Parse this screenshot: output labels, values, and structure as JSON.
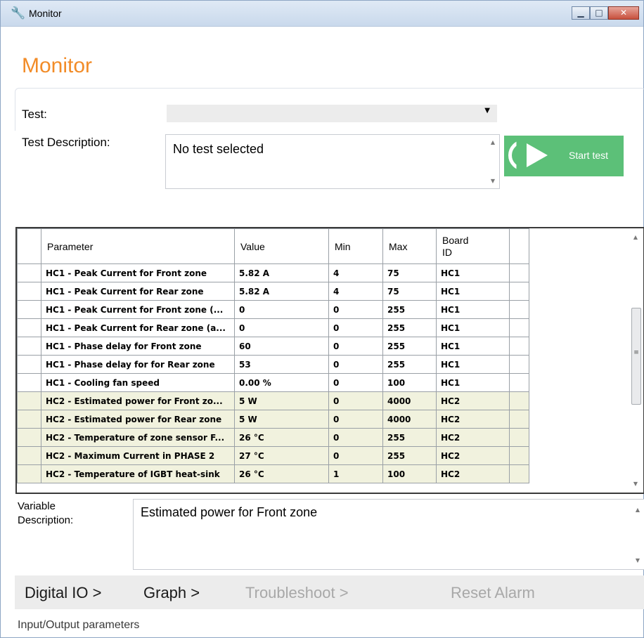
{
  "window": {
    "title": "Monitor",
    "controls": {
      "minimize": "▁",
      "maximize": "□",
      "close": "✕"
    }
  },
  "page": {
    "title": "Monitor"
  },
  "test": {
    "label": "Test:",
    "selected": "",
    "description_label": "Test Description:",
    "description": "No test selected",
    "start_button": "Start test"
  },
  "grid": {
    "columns": [
      "Parameter",
      "Value",
      "Min",
      "Max",
      "Board ID"
    ],
    "rows": [
      {
        "parameter": "HC1 - Peak Current for Front zone",
        "value": "5.82 A",
        "min": "4",
        "max": "75",
        "board": "HC1"
      },
      {
        "parameter": "HC1 - Peak Current for Rear zone",
        "value": "5.82 A",
        "min": "4",
        "max": "75",
        "board": "HC1"
      },
      {
        "parameter": "HC1 - Peak Current for Front zone (...",
        "value": "0",
        "min": "0",
        "max": "255",
        "board": "HC1"
      },
      {
        "parameter": "HC1 - Peak Current for Rear zone (a...",
        "value": "0",
        "min": "0",
        "max": "255",
        "board": "HC1"
      },
      {
        "parameter": "HC1 - Phase delay for Front zone",
        "value": "60",
        "min": "0",
        "max": "255",
        "board": "HC1"
      },
      {
        "parameter": "HC1 - Phase delay for for Rear zone",
        "value": "53",
        "min": "0",
        "max": "255",
        "board": "HC1"
      },
      {
        "parameter": "HC1 - Cooling fan speed",
        "value": "0.00 %",
        "min": "0",
        "max": "100",
        "board": "HC1"
      },
      {
        "parameter": "HC2 - Estimated power for Front zo...",
        "value": "5 W",
        "min": "0",
        "max": "4000",
        "board": "HC2"
      },
      {
        "parameter": "HC2 - Estimated power for Rear zone",
        "value": "5 W",
        "min": "0",
        "max": "4000",
        "board": "HC2"
      },
      {
        "parameter": "HC2 - Temperature of zone sensor F...",
        "value": "26 °C",
        "min": "0",
        "max": "255",
        "board": "HC2"
      },
      {
        "parameter": "HC2 - Maximum Current in PHASE 2",
        "value": "27 °C",
        "min": "0",
        "max": "255",
        "board": "HC2"
      },
      {
        "parameter": "HC2 - Temperature of IGBT heat-sink",
        "value": "26 °C",
        "min": "1",
        "max": "100",
        "board": "HC2"
      }
    ],
    "highlight_color": "#f1f2de"
  },
  "variable": {
    "label": "Variable Description:",
    "description": "Estimated power for Front zone"
  },
  "nav": {
    "digital_io": "Digital IO >",
    "graph": "Graph >",
    "troubleshoot": "Troubleshoot >",
    "reset_alarm": "Reset Alarm"
  },
  "status": {
    "text": "Input/Output parameters"
  },
  "colors": {
    "title_accent": "#f28c28",
    "start_button": "#5cc078",
    "disabled_text": "#a8a8a8"
  }
}
